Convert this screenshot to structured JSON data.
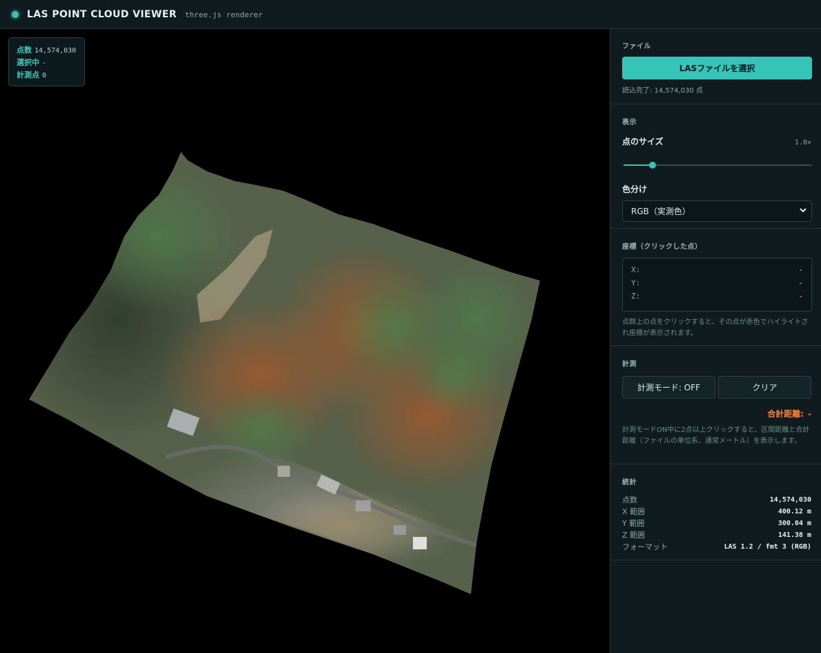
{
  "header": {
    "title": "LAS POINT CLOUD VIEWER",
    "subtitle": "three.js renderer"
  },
  "hud": {
    "points_label": "点数",
    "points_value": "14,574,030",
    "selected_label": "選択中",
    "selected_value": "-",
    "measure_label": "計測点",
    "measure_value": "0"
  },
  "file": {
    "title": "ファイル",
    "button_label": "LASファイルを選択",
    "status": "読込完了: 14,574,030 点"
  },
  "display": {
    "title": "表示",
    "point_size_label": "点のサイズ",
    "point_size_value": "1.0×",
    "point_size_level": 0.155,
    "color_label": "色分け",
    "color_selected": "RGB（実測色）"
  },
  "coords": {
    "title": "座標（クリックした点）",
    "x_label": "X:",
    "x_value": "-",
    "y_label": "Y:",
    "y_value": "-",
    "z_label": "Z:",
    "z_value": "-",
    "help": "点群上の点をクリックすると、その点が赤色でハイライトされ座標が表示されます。"
  },
  "measure": {
    "title": "計測",
    "mode_button": "計測モード: OFF",
    "clear_button": "クリア",
    "total_label": "合計距離:",
    "total_value": "-",
    "help": "計測モードON中に2点以上クリックすると、区間距離と合計距離（ファイルの単位系、通常メートル）を表示します。"
  },
  "stats": {
    "title": "統計",
    "rows": [
      {
        "label": "点数",
        "value": "14,574,030"
      },
      {
        "label": "X 範囲",
        "value": "400.12 m"
      },
      {
        "label": "Y 範囲",
        "value": "300.04 m"
      },
      {
        "label": "Z 範囲",
        "value": "141.38 m"
      },
      {
        "label": "フォーマット",
        "value": "LAS 1.2 / fmt 3 (RGB)"
      }
    ]
  },
  "colors": {
    "accent": "#37c4b8",
    "panel": "#0f1b1f",
    "warning": "#f0873d"
  },
  "icons": {
    "status": "status-dot-icon",
    "select": "chevron-down-icon"
  }
}
